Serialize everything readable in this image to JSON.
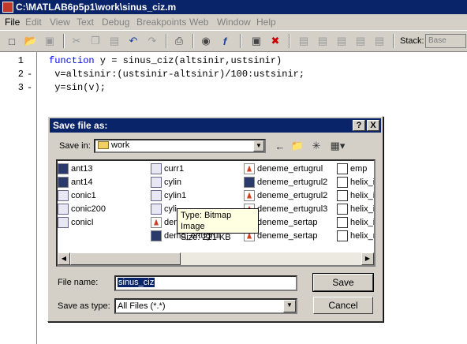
{
  "window": {
    "title": "C:\\MATLAB6p5p1\\work\\sinus_ciz.m"
  },
  "menu": [
    "File",
    "Edit",
    "View",
    "Text",
    "Debug",
    "Breakpoints",
    "Web",
    "Window",
    "Help"
  ],
  "toolbar": {
    "stack_label": "Stack:",
    "stack_value": "Base"
  },
  "editor": {
    "lines": [
      {
        "num": "1",
        "dash": "",
        "kw": "function",
        "text": " y = sinus_ciz(altsinir,ustsinir)"
      },
      {
        "num": "2",
        "dash": "-",
        "kw": "",
        "text": " v=altsinir:(ustsinir-altsinir)/100:ustsinir;"
      },
      {
        "num": "3",
        "dash": "-",
        "kw": "",
        "text": " y=sin(v);"
      }
    ]
  },
  "dialog": {
    "title": "Save file as:",
    "help_btn": "?",
    "close_btn": "X",
    "save_in_label": "Save in:",
    "save_in_value": "work",
    "files": [
      [
        "ant13",
        "ant14",
        "conic1",
        "conic200",
        "conicI"
      ],
      [
        "curr1",
        "cylin",
        "cylin1",
        "cyli",
        "demo",
        "demo_ertugrul"
      ],
      [
        "deneme_ertugrul",
        "deneme_ertugrul2",
        "deneme_ertugrul2",
        "deneme_ertugrul3",
        "deneme_sertap",
        "deneme_sertap"
      ],
      [
        "emp",
        "helix_in",
        "helix_in",
        "helix_in",
        "helix_in",
        "helix_m"
      ]
    ],
    "file_name_label": "File name:",
    "file_name_value": "sinus_ciz",
    "save_as_type_label": "Save as type:",
    "save_as_type_value": "All Files (*.*)",
    "save_button": "Save",
    "cancel_button": "Cancel"
  },
  "tooltip": {
    "type": "Type: Bitmap Image",
    "size": "Size: 221 KB"
  }
}
